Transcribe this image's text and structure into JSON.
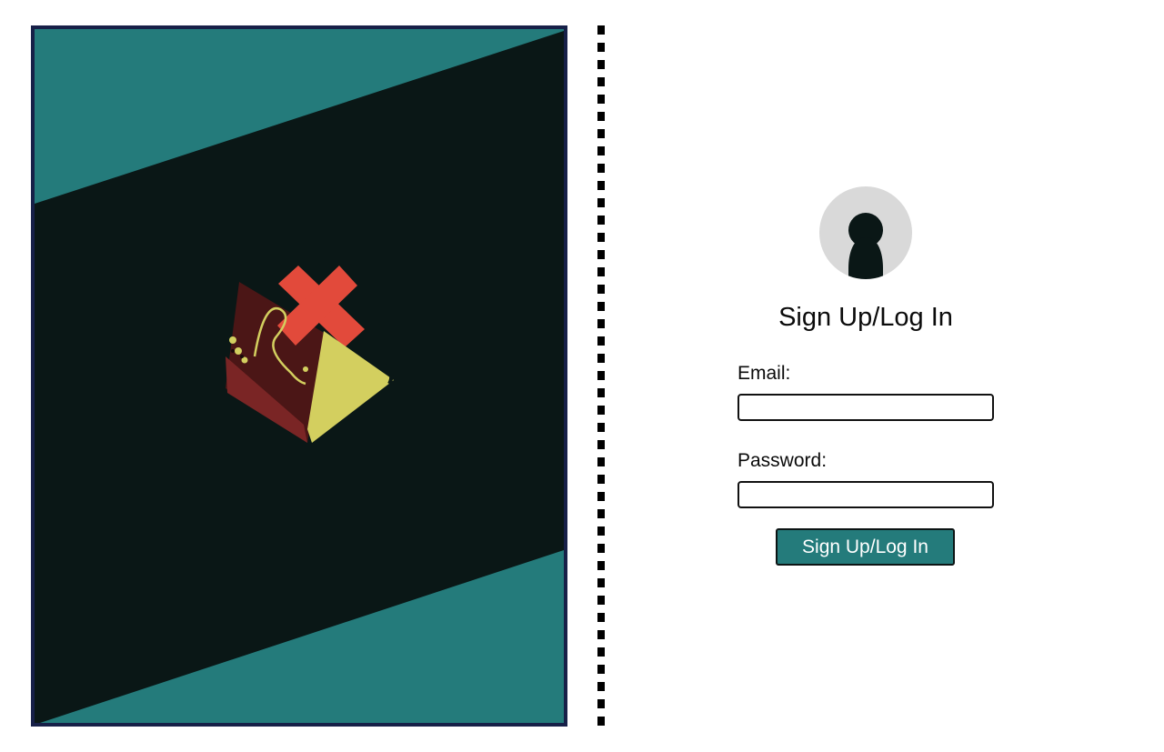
{
  "colors": {
    "accent": "#247b7b",
    "panel_dark": "#0a1716",
    "panel_border": "#172048",
    "avatar_bg": "#d9d9d9",
    "cross_red": "#e24a3b",
    "map_yellow": "#d3cf5f",
    "chest_maroon": "#4b1616"
  },
  "hero": {
    "image_icon": "treasure-map-with-x-icon"
  },
  "auth": {
    "avatar_icon": "user-icon",
    "title": "Sign Up/Log In",
    "email_label": "Email:",
    "email_value": "",
    "password_label": "Password:",
    "password_value": "",
    "submit_label": "Sign Up/Log In"
  }
}
